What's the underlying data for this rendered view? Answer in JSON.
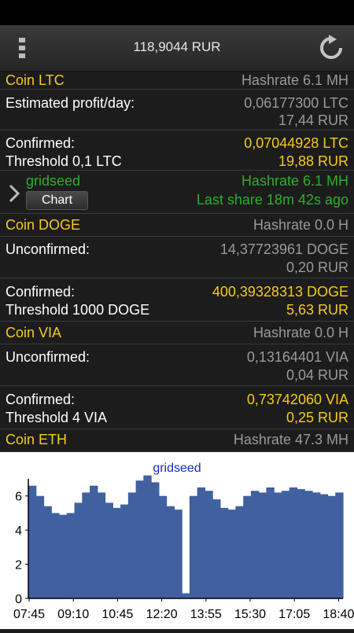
{
  "header": {
    "balance": "118,9044 RUR"
  },
  "coins": {
    "ltc": {
      "title": "Coin LTC",
      "hashrate": "Hashrate 6.1 MH",
      "est_label": "Estimated profit/day:",
      "est_coin": "0,06177300 LTC",
      "est_fiat": "17,44 RUR",
      "confirmed_label": "Confirmed:",
      "threshold_label": "Threshold 0,1 LTC",
      "confirmed_coin": "0,07044928 LTC",
      "confirmed_fiat": "19,88 RUR"
    },
    "worker": {
      "name": "gridseed",
      "chart_button": "Chart",
      "hashrate": "Hashrate 6.1 MH",
      "last_share": "Last share 18m 42s ago"
    },
    "doge": {
      "title": "Coin DOGE",
      "hashrate": "Hashrate 0.0 H",
      "unconf_label": "Unconfirmed:",
      "unconf_coin": "14,37723961 DOGE",
      "unconf_fiat": "0,20 RUR",
      "confirmed_label": "Confirmed:",
      "threshold_label": "Threshold 1000 DOGE",
      "confirmed_coin": "400,39328313 DOGE",
      "confirmed_fiat": "5,63 RUR"
    },
    "via": {
      "title": "Coin VIA",
      "hashrate": "Hashrate 0.0 H",
      "unconf_label": "Unconfirmed:",
      "unconf_coin": "0,13164401 VIA",
      "unconf_fiat": "0,04 RUR",
      "confirmed_label": "Confirmed:",
      "threshold_label": "Threshold 4 VIA",
      "confirmed_coin": "0,73742060 VIA",
      "confirmed_fiat": "0,25 RUR"
    },
    "eth": {
      "title": "Coin ETH",
      "hashrate": "Hashrate 47.3 MH"
    }
  },
  "colors": {
    "accent_yellow": "#f4cc1a",
    "worker_green": "#2fae2f",
    "chart_fill": "#4060a0",
    "chart_title": "#1030d0"
  },
  "chart_data": {
    "type": "area",
    "title": "gridseed",
    "xlabel": "",
    "ylabel": "",
    "ylim": [
      0,
      7
    ],
    "y_ticks": [
      "0",
      "2",
      "4",
      "6"
    ],
    "x_ticks": [
      "07:45",
      "09:10",
      "10:45",
      "12:20",
      "13:55",
      "15:30",
      "17:05",
      "18:40"
    ],
    "x": [
      "07:45",
      "08:02",
      "08:19",
      "08:36",
      "08:53",
      "09:10",
      "09:27",
      "09:44",
      "10:01",
      "10:18",
      "10:35",
      "10:52",
      "11:09",
      "11:26",
      "11:43",
      "12:00",
      "12:17",
      "12:34",
      "12:51",
      "13:08",
      "13:25",
      "13:42",
      "13:59",
      "14:16",
      "14:33",
      "14:50",
      "15:07",
      "15:24",
      "15:41",
      "15:58",
      "16:15",
      "16:32",
      "16:49",
      "17:06",
      "17:23",
      "17:40",
      "17:57",
      "18:14",
      "18:31",
      "18:48",
      "19:05"
    ],
    "series": [
      {
        "values": [
          6.6,
          6.0,
          5.4,
          5.0,
          4.9,
          5.0,
          5.6,
          6.2,
          6.6,
          6.2,
          5.6,
          5.3,
          5.5,
          6.2,
          6.9,
          7.2,
          6.8,
          6.0,
          5.4,
          5.2,
          0.3,
          6.0,
          6.5,
          6.3,
          5.8,
          5.3,
          5.2,
          5.4,
          6.0,
          6.3,
          6.2,
          6.5,
          6.2,
          6.3,
          6.5,
          6.4,
          6.3,
          6.2,
          6.1,
          6.0,
          6.2
        ]
      }
    ]
  }
}
